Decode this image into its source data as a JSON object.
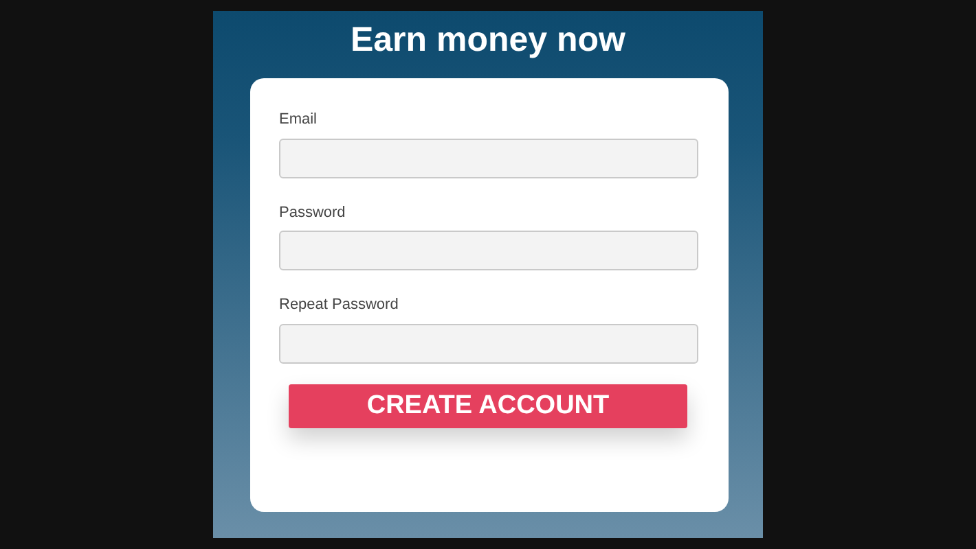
{
  "title": "Earn money now",
  "fields": [
    {
      "label": "Email"
    },
    {
      "label": "Password"
    },
    {
      "label": "Repeat Password"
    }
  ],
  "button": "CREATE ACCOUNT"
}
